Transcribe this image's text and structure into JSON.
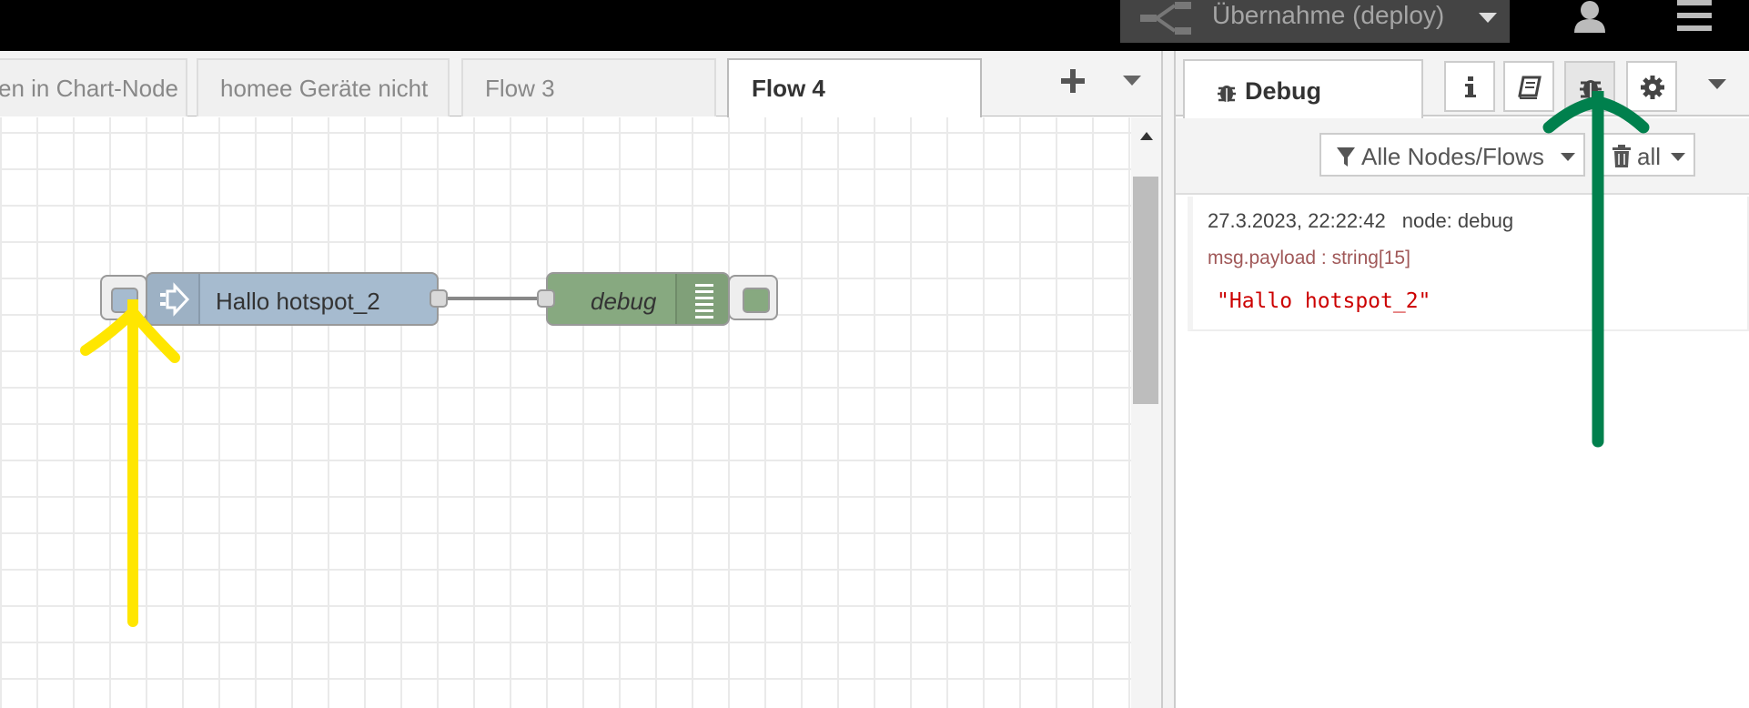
{
  "header": {
    "deploy_label": "Übernahme (deploy)"
  },
  "workspace": {
    "tabs": [
      {
        "label": "en in Chart-Node",
        "active": false
      },
      {
        "label": "homee Geräte nicht",
        "active": false
      },
      {
        "label": "Flow 3",
        "active": false
      },
      {
        "label": "Flow 4",
        "active": true
      }
    ],
    "nodes": [
      {
        "type": "inject",
        "label": "Hallo hotspot_2",
        "color": "#a6bbcf"
      },
      {
        "type": "debug",
        "label": "debug",
        "color": "#87a980"
      }
    ]
  },
  "sidebar": {
    "active_tab": "Debug",
    "filter_label": "Alle Nodes/Flows",
    "clear_label": "all",
    "messages": [
      {
        "timestamp": "27.3.2023, 22:22:42",
        "node": "node: debug",
        "property": "msg.payload : string[15]",
        "value": "\"Hallo hotspot_2\""
      }
    ]
  },
  "annotations": {
    "yellow_arrow_color": "#ffe600",
    "green_arrow_color": "#00804d"
  }
}
